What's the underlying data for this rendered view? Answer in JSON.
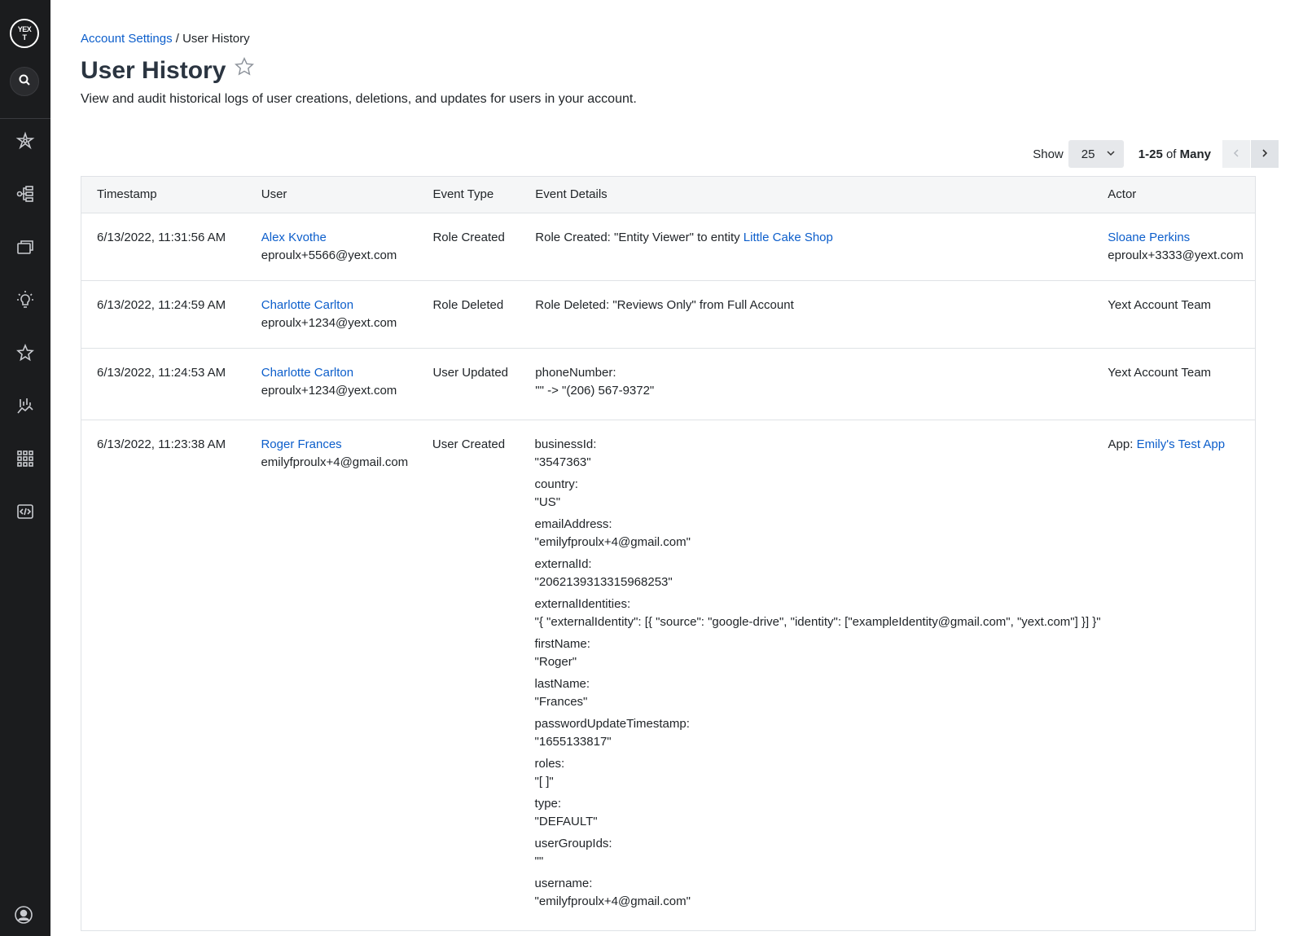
{
  "sidebar": {
    "logo_text": "YEXT",
    "items": [
      {
        "icon": "knowledge-graph-icon"
      },
      {
        "icon": "hierarchy-icon"
      },
      {
        "icon": "pages-icon"
      },
      {
        "icon": "lightbulb-icon"
      },
      {
        "icon": "reviews-star-icon"
      },
      {
        "icon": "analytics-icon"
      },
      {
        "icon": "apps-grid-icon"
      },
      {
        "icon": "developer-code-icon"
      }
    ]
  },
  "breadcrumb": {
    "parent": "Account Settings",
    "separator": " / ",
    "current": "User History"
  },
  "page": {
    "title": "User History",
    "subtitle": "View and audit historical logs of user creations, deletions, and updates for users in your account."
  },
  "pager": {
    "show_label": "Show",
    "page_size": "25",
    "range": "1-25",
    "of": " of ",
    "total": "Many"
  },
  "table": {
    "headers": [
      "Timestamp",
      "User",
      "Event Type",
      "Event Details",
      "Actor"
    ],
    "rows": [
      {
        "timestamp": "6/13/2022, 11:31:56 AM",
        "user_name": "Alex Kvothe",
        "user_email": "eproulx+5566@yext.com",
        "event_type": "Role Created",
        "details_prefix": "Role Created: \"Entity Viewer\" to entity ",
        "details_link": "Little Cake Shop",
        "actor_name": "Sloane Perkins",
        "actor_email": "eproulx+3333@yext.com"
      },
      {
        "timestamp": "6/13/2022, 11:24:59 AM",
        "user_name": "Charlotte Carlton",
        "user_email": "eproulx+1234@yext.com",
        "event_type": "Role Deleted",
        "details": "Role Deleted: \"Reviews Only\" from Full Account",
        "actor": "Yext Account Team"
      },
      {
        "timestamp": "6/13/2022, 11:24:53 AM",
        "user_name": "Charlotte Carlton",
        "user_email": "eproulx+1234@yext.com",
        "event_type": "User Updated",
        "detail_key": "phoneNumber:",
        "detail_value": "\"\" -> \"(206) 567-9372\"",
        "actor": "Yext Account Team"
      },
      {
        "timestamp": "6/13/2022, 11:23:38 AM",
        "user_name": "Roger Frances",
        "user_email": "emilyfproulx+4@gmail.com",
        "event_type": "User Created",
        "details": [
          {
            "key": "businessId:",
            "value": "\"3547363\""
          },
          {
            "key": "country:",
            "value": "\"US\""
          },
          {
            "key": "emailAddress:",
            "value": "\"emilyfproulx+4@gmail.com\""
          },
          {
            "key": "externalId:",
            "value": "\"2062139313315968253\""
          },
          {
            "key": "externalIdentities:",
            "value": "\"{ \"externalIdentity\": [{ \"source\": \"google-drive\", \"identity\": [\"exampleIdentity@gmail.com\", \"yext.com\"] }] }\""
          },
          {
            "key": "firstName:",
            "value": "\"Roger\""
          },
          {
            "key": "lastName:",
            "value": "\"Frances\""
          },
          {
            "key": "passwordUpdateTimestamp:",
            "value": "\"1655133817\""
          },
          {
            "key": "roles:",
            "value": "\"[ ]\""
          },
          {
            "key": "type:",
            "value": "\"DEFAULT\""
          },
          {
            "key": "userGroupIds:",
            "value": "\"\""
          },
          {
            "key": "username:",
            "value": "\"emilyfproulx+4@gmail.com\""
          }
        ],
        "actor_prefix": "App: ",
        "actor_link": "Emily's Test App"
      }
    ]
  }
}
